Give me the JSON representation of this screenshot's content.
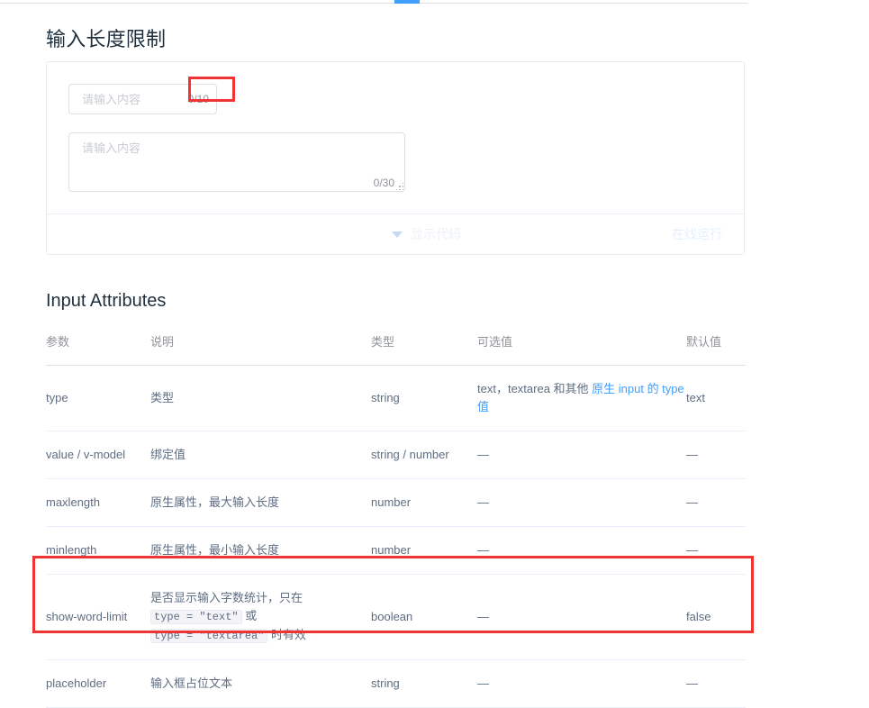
{
  "tabs": {
    "active_indicator_color": "#409eff"
  },
  "section": {
    "title": "输入长度限制"
  },
  "demo": {
    "input": {
      "placeholder": "请输入内容",
      "value": "",
      "word_count": "0/10"
    },
    "textarea": {
      "placeholder": "请输入内容",
      "value": "",
      "word_count": "0/30"
    },
    "footer": {
      "show_code_label": "显示代码",
      "run_online_label": "在线运行"
    }
  },
  "attributes": {
    "title": "Input Attributes",
    "columns": [
      "参数",
      "说明",
      "类型",
      "可选值",
      "默认值"
    ],
    "rows": [
      {
        "param": "type",
        "desc": "类型",
        "type": "string",
        "options_prefix": "text，textarea 和其他 ",
        "options_link": "原生 input 的 type 值",
        "default": "text",
        "highlight": false
      },
      {
        "param": "value / v-model",
        "desc": "绑定值",
        "type": "string / number",
        "options": "—",
        "default": "—",
        "highlight": false
      },
      {
        "param": "maxlength",
        "desc": "原生属性，最大输入长度",
        "type": "number",
        "options": "—",
        "default": "—",
        "highlight": false
      },
      {
        "param": "minlength",
        "desc": "原生属性，最小输入长度",
        "type": "number",
        "options": "—",
        "default": "—",
        "highlight": false
      },
      {
        "param": "show-word-limit",
        "desc_part1": "是否显示输入字数统计，只在 ",
        "desc_code1": "type = \"text\"",
        "desc_part2": " 或 ",
        "desc_code2": "type = \"textarea\"",
        "desc_part3": " 时有效",
        "type": "boolean",
        "options": "—",
        "default": "false",
        "highlight": true
      },
      {
        "param": "placeholder",
        "desc": "输入框占位文本",
        "type": "string",
        "options": "—",
        "default": "—",
        "highlight": false
      }
    ]
  },
  "annotations": {
    "box_color": "#f03434"
  }
}
